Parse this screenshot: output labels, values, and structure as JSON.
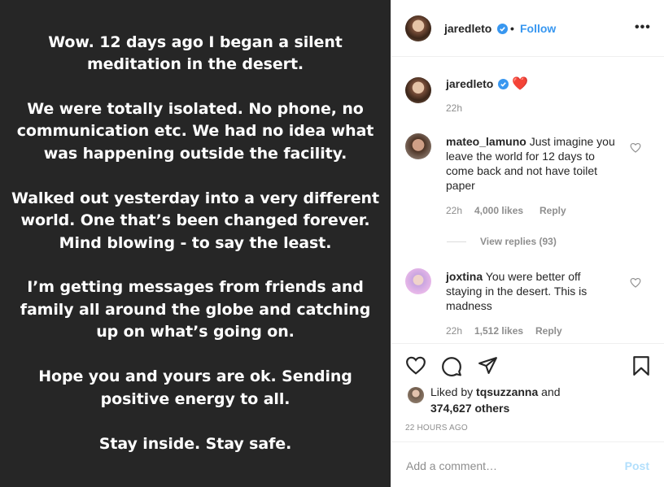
{
  "image_text": [
    "Wow. 12 days ago I began a silent",
    "meditation in the desert.",
    "We were totally isolated. No phone, no",
    "communication etc. We had no idea what",
    "was happening outside the facility.",
    "Walked out yesterday into a very different",
    "world. One that’s been changed forever.",
    "Mind blowing - to say the least.",
    "I’m getting messages from friends and",
    "family all around the globe and catching",
    "up on what’s going on.",
    "Hope you and yours are ok. Sending",
    "positive energy to all.",
    "Stay inside. Stay safe."
  ],
  "header": {
    "username": "jaredleto",
    "separator": "•",
    "follow_label": "Follow",
    "more_label": "•••"
  },
  "caption": {
    "username": "jaredleto",
    "emoji": "❤️",
    "time": "22h"
  },
  "comments": [
    {
      "username": "mateo_lamuno",
      "text_lines": [
        "Just imagine you",
        "leave the world for 12 days to",
        "come back and not have toilet",
        "paper"
      ],
      "time": "22h",
      "likes": "4,000 likes",
      "reply_label": "Reply",
      "view_replies": "View replies (93)"
    },
    {
      "username": "joxtina",
      "text_lines": [
        "You were better off",
        "staying in the desert. This is",
        "madness"
      ],
      "time": "22h",
      "likes": "1,512 likes",
      "reply_label": "Reply"
    }
  ],
  "likes": {
    "prefix": "Liked by",
    "user": "tqsuzzanna",
    "and": "and",
    "others": "374,627 others"
  },
  "posted_ago": "22 HOURS AGO",
  "add_comment": {
    "placeholder": "Add a comment…",
    "post_label": "Post"
  },
  "colors": {
    "accent": "#3897f0",
    "image_bg": "#262626",
    "heart": "#ed4956",
    "post_disabled": "#b2dffc"
  }
}
